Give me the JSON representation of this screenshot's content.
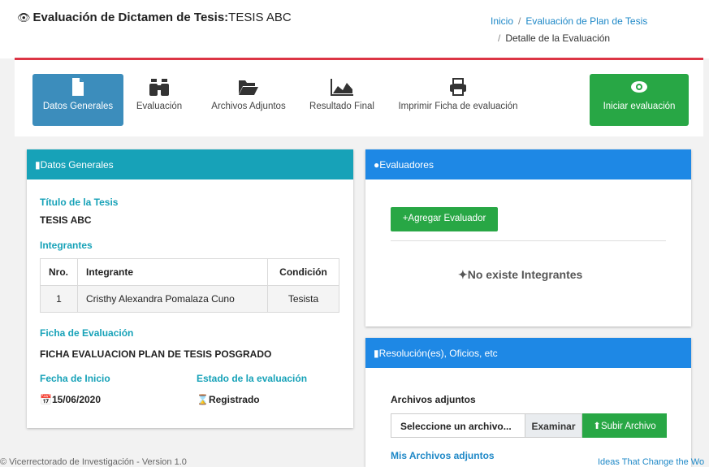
{
  "header": {
    "title_prefix": "Evaluación de Dictamen de Tesis:",
    "title_value": "TESIS ABC",
    "breadcrumb": [
      "Inicio",
      "Evaluación de Plan de Tesis",
      "Detalle de la Evaluación"
    ]
  },
  "toolbar": {
    "items": [
      {
        "label": "Datos Generales",
        "icon": "file-icon"
      },
      {
        "label": "Evaluación",
        "icon": "binoculars-icon"
      },
      {
        "label": "Archivos Adjuntos",
        "icon": "folder-open-icon"
      },
      {
        "label": "Resultado Final",
        "icon": "area-chart-icon"
      },
      {
        "label": "Imprimir Ficha de evaluación",
        "icon": "print-icon"
      }
    ],
    "start_label": "Iniciar evaluación",
    "start_icon": "eye-icon"
  },
  "datos": {
    "heading": "Datos Generales",
    "titulo_label": "Título de la Tesis",
    "titulo_value": "TESIS ABC",
    "integrantes_label": "Integrantes",
    "table": {
      "headers": [
        "Nro.",
        "Integrante",
        "Condición"
      ],
      "rows": [
        [
          "1",
          "Cristhy Alexandra Pomalaza Cuno",
          "Tesista"
        ]
      ]
    },
    "ficha_label": "Ficha de Evaluación",
    "ficha_value": "FICHA EVALUACION PLAN DE TESIS POSGRADO",
    "fecha_label": "Fecha de Inicio",
    "fecha_value": "15/06/2020",
    "estado_label": "Estado de la evaluación",
    "estado_value": "Registrado"
  },
  "evaluadores": {
    "heading": "Evaluadores",
    "add_label": "Agregar Evaluador",
    "empty_label": "No existe Integrantes"
  },
  "resoluciones": {
    "heading": "Resolución(es), Oficios, etc",
    "adjuntos_label": "Archivos adjuntos",
    "file_placeholder": "Seleccione un archivo...",
    "browse_label": "Examinar",
    "upload_label": "Subir Archivo",
    "mis_archivos_label": "Mis Archivos adjuntos"
  },
  "footer": {
    "left": "© Vicerrectorado de Investigación - Version 1.0",
    "right": "Ideas That Change the Wo"
  },
  "colors": {
    "primary": "#3c8dbc",
    "success": "#28a745",
    "teal": "#17a2b8",
    "blue": "#1e88e5",
    "danger": "#dc3545"
  }
}
